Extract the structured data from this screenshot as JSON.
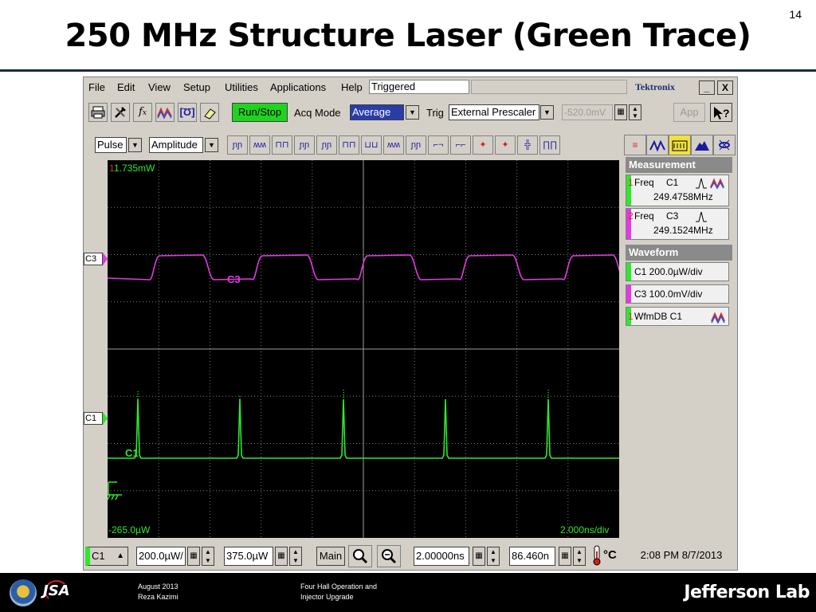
{
  "slide": {
    "number": "14",
    "title": "250 MHz Structure Laser (Green Trace)"
  },
  "scope": {
    "menu": [
      "File",
      "Edit",
      "View",
      "Setup",
      "Utilities",
      "Applications",
      "Help"
    ],
    "status_field": "Triggered",
    "brand": "Tektronix",
    "window_buttons": [
      "_",
      "X"
    ],
    "toolbar1": {
      "run_stop": "Run/Stop",
      "acq_mode_label": "Acq Mode",
      "acq_mode_value": "Average",
      "trig_label": "Trig",
      "trig_value": "External Prescaler",
      "trig_level": "-520.0mV",
      "app_label": "App",
      "help_label": "?"
    },
    "toolbar2": {
      "trigger_type": "Pulse",
      "pulse_class": "Amplitude",
      "pulse_icons": [
        "pulse-icon-1",
        "pulse-icon-2",
        "pulse-icon-3",
        "pulse-icon-4",
        "pulse-icon-5",
        "pulse-icon-6",
        "pulse-icon-7",
        "pulse-icon-8",
        "pulse-icon-9",
        "pulse-icon-10",
        "pulse-icon-11",
        "pulse-icon-12",
        "pulse-icon-13",
        "pulse-icon-14",
        "pulse-icon-15"
      ]
    },
    "display": {
      "top_label": "1.735mW",
      "bottom_label": "-265.0µW",
      "timebase_label": "2.000ns/div",
      "c3_marker": "C3",
      "c1_marker": "C1",
      "c3_trace_label": "C3",
      "c1_trace_label": "C1",
      "c1_color": "#2ee82e",
      "c3_color": "#e23ae2"
    },
    "measurement": {
      "heading": "Measurement",
      "items": [
        {
          "index": "1",
          "name": "Freq",
          "source": "C1",
          "value": "249.4758MHz",
          "color": "#2ee82e"
        },
        {
          "index": "2",
          "name": "Freq",
          "source": "C3",
          "value": "249.1524MHz",
          "color": "#e23ae2"
        }
      ]
    },
    "waveform": {
      "heading": "Waveform",
      "items": [
        {
          "text": "C1 200.0µW/div",
          "color": "#2ee82e"
        },
        {
          "text": "C3 100.0mV/div",
          "color": "#e23ae2"
        },
        {
          "index": "1",
          "text": "WfmDB C1",
          "color": "#2ee82e"
        }
      ]
    },
    "bottom": {
      "channel": "C1",
      "vert_scale": "200.0µW/",
      "offset": "375.0µW",
      "main_label": "Main",
      "horiz_scale": "2.00000ns",
      "position": "86.460n",
      "temp_label": "°C",
      "datetime": "2:08 PM 8/7/2013"
    }
  },
  "footer": {
    "date": "August 2013",
    "author": "Reza Kazimi",
    "talk_line1": "Four Hall Operation and",
    "talk_line2": "Injector Upgrade",
    "logo_text": "Jefferson Lab",
    "jsa_text": "JSA"
  }
}
